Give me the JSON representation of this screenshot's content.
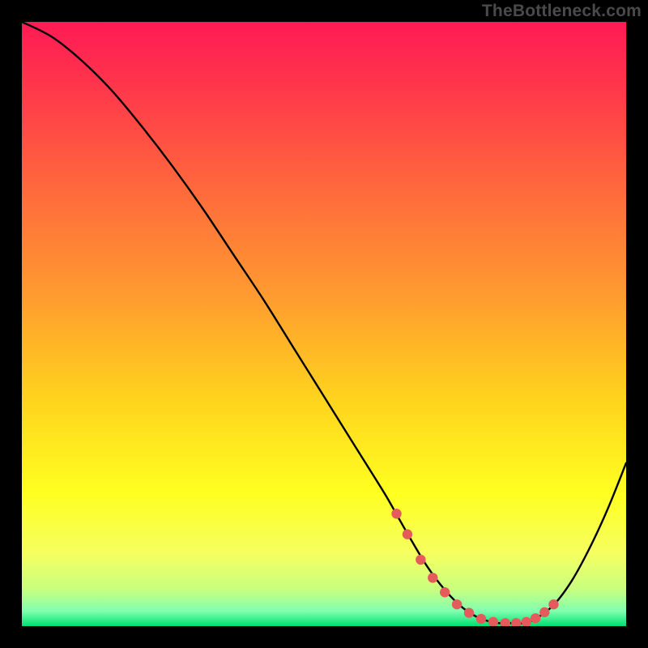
{
  "watermark": "TheBottleneck.com",
  "colors": {
    "frame": "#000000",
    "watermark": "#4a4a4a",
    "curve": "#000000",
    "dots": "#e55a5a",
    "gradient_stops": [
      {
        "offset": 0.0,
        "color": "#ff1a54"
      },
      {
        "offset": 0.12,
        "color": "#ff3a4a"
      },
      {
        "offset": 0.28,
        "color": "#ff6a3c"
      },
      {
        "offset": 0.45,
        "color": "#ff9a30"
      },
      {
        "offset": 0.62,
        "color": "#ffd21e"
      },
      {
        "offset": 0.78,
        "color": "#ffff20"
      },
      {
        "offset": 0.88,
        "color": "#f5ff60"
      },
      {
        "offset": 0.94,
        "color": "#c8ff80"
      },
      {
        "offset": 0.975,
        "color": "#80ffb0"
      },
      {
        "offset": 1.0,
        "color": "#00e070"
      }
    ]
  },
  "chart_data": {
    "type": "line",
    "title": "",
    "xlabel": "",
    "ylabel": "",
    "xlim": [
      0,
      100
    ],
    "ylim": [
      0,
      100
    ],
    "series": [
      {
        "name": "bottleneck-curve",
        "x": [
          0,
          5,
          10,
          15,
          20,
          25,
          30,
          35,
          40,
          45,
          50,
          55,
          60,
          62,
          64,
          67,
          70,
          73,
          76,
          79,
          81,
          83,
          85,
          88,
          91,
          94,
          97,
          100
        ],
        "y": [
          100,
          97.5,
          93.5,
          88.5,
          82.5,
          76,
          69,
          61.5,
          54,
          46,
          38,
          30,
          22,
          18.5,
          15,
          10,
          6,
          3,
          1.2,
          0.5,
          0.5,
          0.5,
          1.2,
          3.5,
          7.5,
          13,
          19.5,
          27
        ]
      }
    ],
    "highlight_dots": {
      "name": "optimal-zone",
      "x": [
        62.0,
        63.8,
        66.0,
        68.0,
        70.0,
        72.0,
        74.0,
        76.0,
        78.0,
        80.0,
        81.8,
        83.5,
        85.0,
        86.5,
        88.0
      ],
      "y": [
        18.6,
        15.2,
        11.0,
        8.0,
        5.6,
        3.6,
        2.2,
        1.2,
        0.7,
        0.5,
        0.5,
        0.7,
        1.3,
        2.3,
        3.6
      ]
    }
  }
}
